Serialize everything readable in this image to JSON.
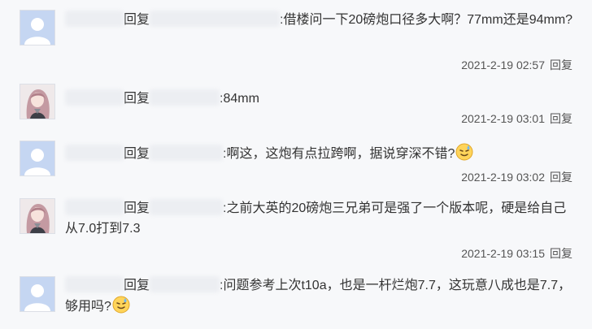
{
  "replies": [
    {
      "reply_word": "回复",
      "colon_text": ":借楼问一下20磅炮口径多大啊？77mm还是94mm?",
      "time": "2021-2-19 02:57",
      "reply_link": "回复",
      "avatar": "default-avatar-icon"
    },
    {
      "reply_word": "回复",
      "colon_text": ":84mm",
      "time": "2021-2-19 03:01",
      "reply_link": "回复",
      "avatar": "anime-girl-avatar"
    },
    {
      "reply_word": "回复",
      "colon_text": ":啊这，这炮有点拉跨啊，据说穿深不错?",
      "time": "2021-2-19 03:02",
      "reply_link": "回复",
      "avatar": "default-avatar-icon",
      "emoji": "sweat-smile-emoji"
    },
    {
      "reply_word": "回复",
      "colon_text": ":之前大英的20磅炮三兄弟可是强了一个版本呢，硬是给自己从7.0打到7.3",
      "time": "2021-2-19 03:15",
      "reply_link": "回复",
      "avatar": "anime-girl-avatar"
    },
    {
      "reply_word": "回复",
      "colon_text": ":问题参考上次t10a，也是一杆烂炮7.7，这玩意八成也是7.7，够用吗?",
      "time": "",
      "reply_link": "",
      "avatar": "default-avatar-icon",
      "emoji": "sweat-smile-emoji"
    }
  ]
}
